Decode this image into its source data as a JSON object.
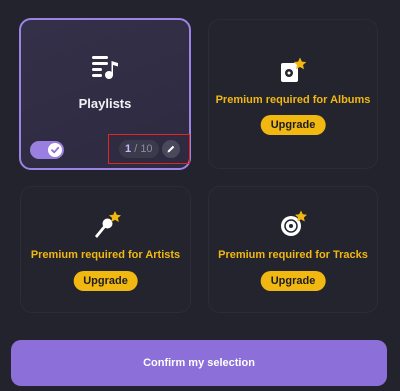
{
  "cards": {
    "playlists": {
      "title": "Playlists",
      "icon": "playlist-icon",
      "selected": true,
      "enabled": true,
      "count_current": "1",
      "count_separator": "/",
      "count_max": "10"
    },
    "albums": {
      "premium_text": "Premium required for Albums",
      "button": "Upgrade",
      "icon": "album-star-icon"
    },
    "artists": {
      "premium_text": "Premium required for Artists",
      "button": "Upgrade",
      "icon": "microphone-star-icon"
    },
    "tracks": {
      "premium_text": "Premium required for Tracks",
      "button": "Upgrade",
      "icon": "vinyl-star-icon"
    }
  },
  "confirm_button": "Confirm my selection",
  "colors": {
    "background": "#22232c",
    "accent": "#9d83e6",
    "premium": "#f2b812",
    "button": "#8c6fd9"
  }
}
